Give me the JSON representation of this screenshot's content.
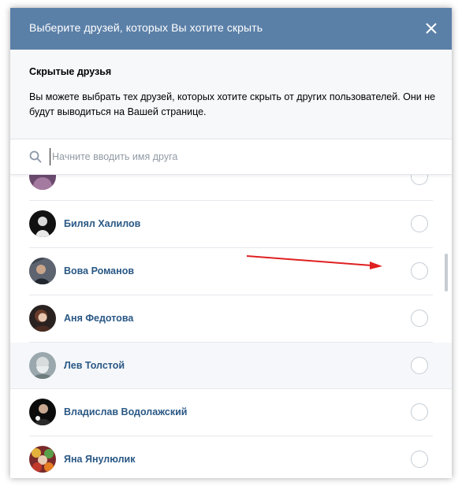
{
  "dialog": {
    "title": "Выберите друзей, которых Вы хотите скрыть",
    "close_icon": "close-icon"
  },
  "info": {
    "title": "Скрытые друзья",
    "text": "Вы можете выбрать тех друзей, которых хотите скрыть от других пользователей. Они не будут выводиться на Вашей странице."
  },
  "search": {
    "placeholder": "Начните вводить имя друга",
    "icon": "search-icon"
  },
  "friends": [
    {
      "name": ""
    },
    {
      "name": "Билял Халилов"
    },
    {
      "name": "Вова Романов"
    },
    {
      "name": "Аня Федотова"
    },
    {
      "name": "Лев Толстой"
    },
    {
      "name": "Владислав Водолажский"
    },
    {
      "name": "Яна Янулюлик"
    }
  ],
  "colors": {
    "header_bg": "#5b80a8",
    "name_link": "#2a5885",
    "arrow": "#e02020"
  }
}
